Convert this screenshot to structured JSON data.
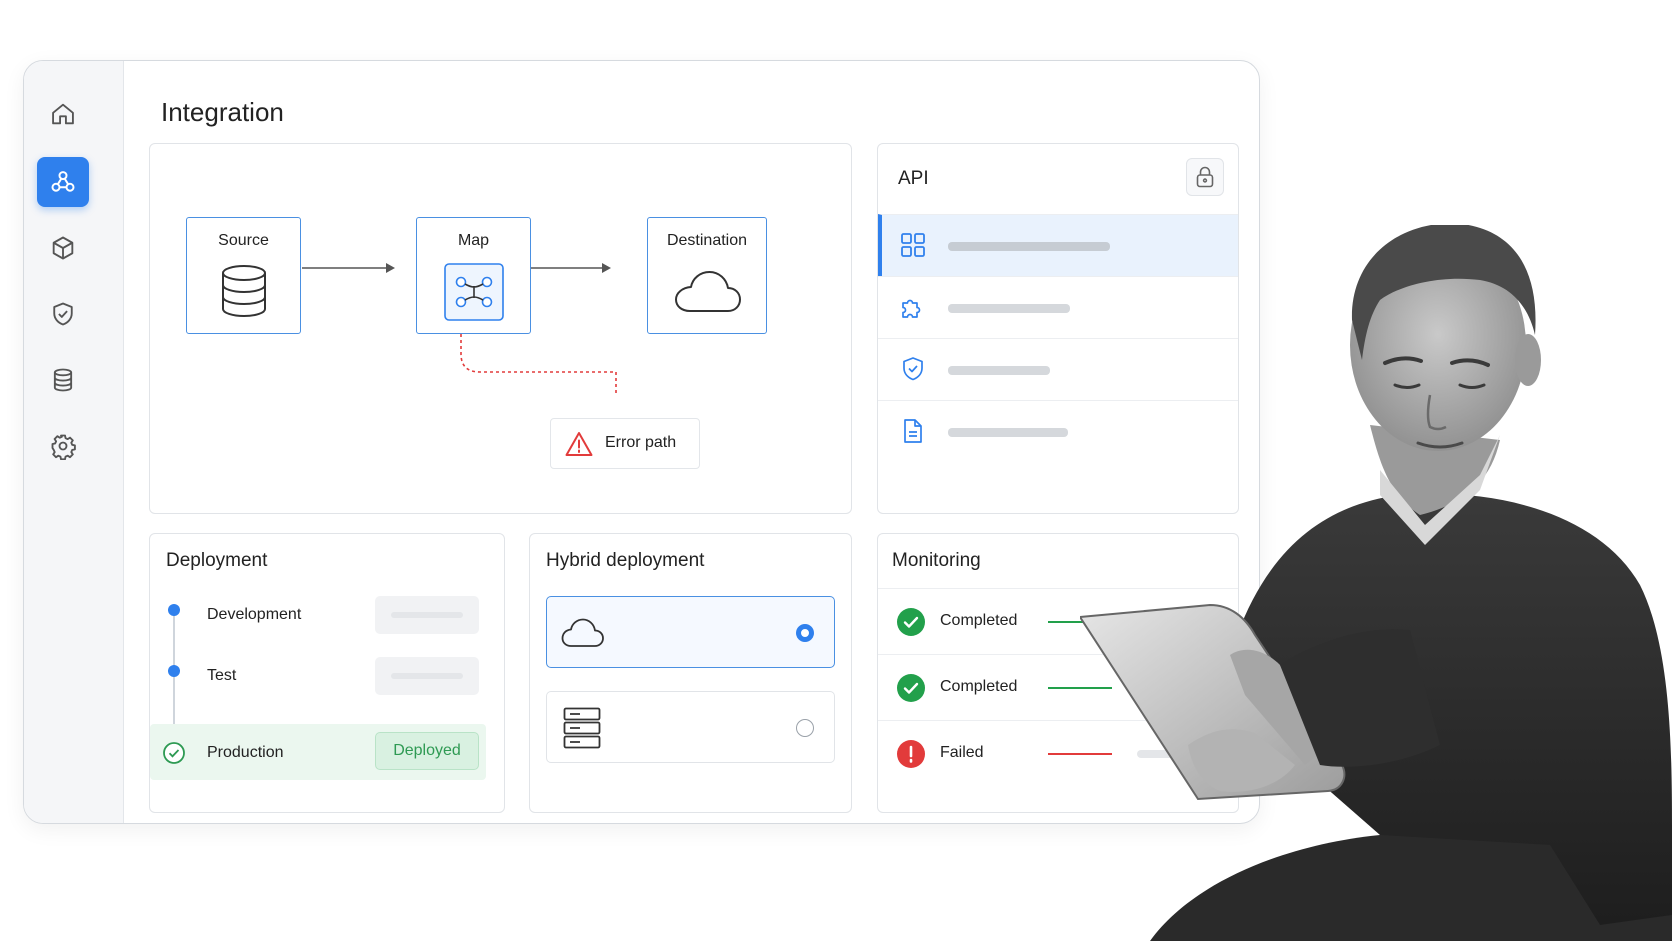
{
  "page": {
    "title": "Integration"
  },
  "sidebar": {
    "items": [
      {
        "icon": "home-icon",
        "active": false
      },
      {
        "icon": "integration-icon",
        "active": true
      },
      {
        "icon": "cube-icon",
        "active": false
      },
      {
        "icon": "shield-check-icon",
        "active": false
      },
      {
        "icon": "database-icon",
        "active": false
      },
      {
        "icon": "gear-icon",
        "active": false
      }
    ]
  },
  "flow": {
    "nodes": [
      {
        "label": "Source",
        "icon": "database-icon"
      },
      {
        "label": "Map",
        "icon": "mapping-icon"
      },
      {
        "label": "Destination",
        "icon": "cloud-icon"
      }
    ],
    "error": {
      "label": "Error path",
      "icon": "warning-icon"
    }
  },
  "api": {
    "title": "API",
    "lock_icon": "lock-icon",
    "items": [
      {
        "icon": "grid-icon",
        "active": true
      },
      {
        "icon": "puzzle-icon",
        "active": false
      },
      {
        "icon": "shield-check-icon",
        "active": false
      },
      {
        "icon": "document-icon",
        "active": false
      }
    ]
  },
  "deployment": {
    "title": "Deployment",
    "stages": [
      {
        "label": "Development"
      },
      {
        "label": "Test"
      },
      {
        "label": "Production",
        "badge": "Deployed"
      }
    ]
  },
  "hybrid": {
    "title": "Hybrid deployment",
    "options": [
      {
        "icon": "cloud-icon",
        "selected": true
      },
      {
        "icon": "server-icon",
        "selected": false
      }
    ]
  },
  "monitoring": {
    "title": "Monitoring",
    "rows": [
      {
        "status": "Completed",
        "icon": "check-circle-icon"
      },
      {
        "status": "Completed",
        "icon": "check-circle-icon"
      },
      {
        "status": "Failed",
        "icon": "error-circle-icon"
      }
    ]
  },
  "colors": {
    "accent": "#2f80ed",
    "success": "#22a04b",
    "error": "#e23b3b"
  }
}
